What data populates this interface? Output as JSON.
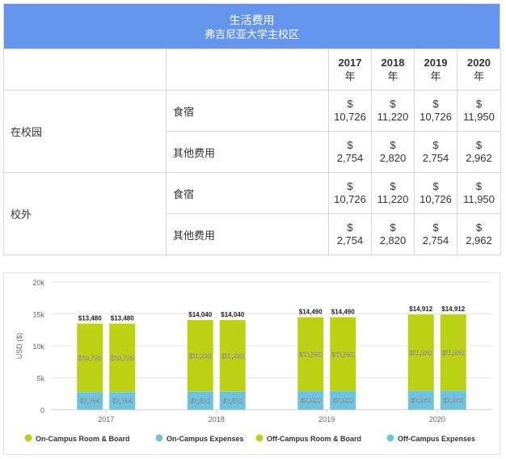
{
  "table": {
    "title": "生活费用",
    "subtitle": "弗吉尼亚大学主校区",
    "years": [
      "2017",
      "2018",
      "2019",
      "2020"
    ],
    "year_suffix": "年",
    "currency": "$",
    "groups": [
      {
        "name": "在校园",
        "rows": [
          {
            "label": "食宿",
            "values": [
              "10,726",
              "11,220",
              "10,726",
              "11,950"
            ]
          },
          {
            "label": "其他费用",
            "values": [
              "2,754",
              "2,820",
              "2,754",
              "2,962"
            ]
          }
        ]
      },
      {
        "name": "校外",
        "rows": [
          {
            "label": "食宿",
            "values": [
              "10,726",
              "11,220",
              "10,726",
              "11,950"
            ]
          },
          {
            "label": "其他费用",
            "values": [
              "2,754",
              "2,820",
              "2,754",
              "2,962"
            ]
          }
        ]
      }
    ]
  },
  "chart_data": {
    "type": "bar",
    "stacked": true,
    "categories": [
      "2017",
      "2018",
      "2019",
      "2020"
    ],
    "ylabel": "USD ($)",
    "ylim": [
      0,
      20000
    ],
    "yticks": [
      0,
      5000,
      10000,
      15000,
      20000
    ],
    "ytick_labels": [
      "0",
      "5k",
      "10k",
      "15k",
      "20k"
    ],
    "grid": true,
    "legend_position": "bottom",
    "stacks": [
      {
        "name": "On-Campus",
        "total_labels": [
          "$13,480",
          "$14,040",
          "$14,490",
          "$14,912"
        ],
        "series": [
          {
            "name": "On-Campus Expenses",
            "color": "#6cc4e0",
            "values": [
              2754,
              2820,
              2900,
              2962
            ],
            "labels": [
              "$2,754",
              "$2,820",
              "$2,900",
              "$2,962"
            ]
          },
          {
            "name": "On-Campus Room & Board",
            "color": "#bcd114",
            "values": [
              10726,
              11220,
              11590,
              11950
            ],
            "labels": [
              "$10,726",
              "$11,220",
              "$11,590",
              "$11,950"
            ]
          }
        ]
      },
      {
        "name": "Off-Campus",
        "total_labels": [
          "$13,480",
          "$14,040",
          "$14,490",
          "$14,912"
        ],
        "series": [
          {
            "name": "Off-Campus Expenses",
            "color": "#6cc4e0",
            "values": [
              2754,
              2820,
              2900,
              2962
            ],
            "labels": [
              "$2,754",
              "$2,820",
              "$2,900",
              "$2,962"
            ]
          },
          {
            "name": "Off-Campus Room & Board",
            "color": "#bcd114",
            "values": [
              10726,
              11220,
              11590,
              11950
            ],
            "labels": [
              "$10,726",
              "$11,220",
              "$11,590",
              "$11,950"
            ]
          }
        ]
      }
    ],
    "legend": [
      {
        "label": "On-Campus Room & Board",
        "color": "#bcd114"
      },
      {
        "label": "On-Campus Expenses",
        "color": "#6cc4e0"
      },
      {
        "label": "Off-Campus Room & Board",
        "color": "#bcd114"
      },
      {
        "label": "Off-Campus Expenses",
        "color": "#6cc4e0"
      }
    ]
  }
}
